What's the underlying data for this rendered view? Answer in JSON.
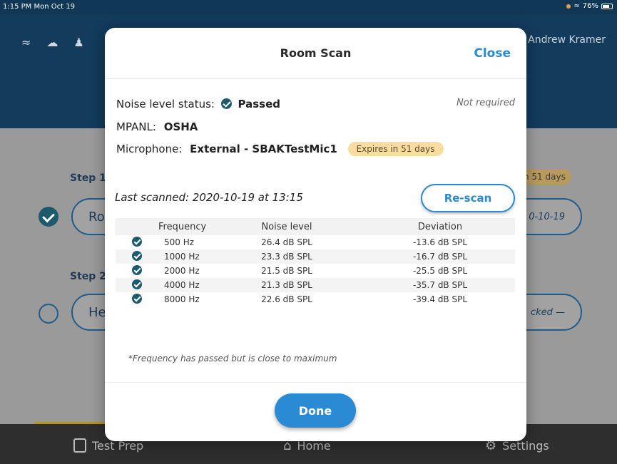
{
  "status_bar": {
    "time": "1:15 PM  Mon Oct 19",
    "battery": "76%",
    "accent_color": "#e8a33a"
  },
  "app": {
    "user_name": "Andrew Kramer",
    "steps": [
      {
        "label": "Step 1",
        "pill_text": "Ro",
        "right_text": "0-10-19"
      },
      {
        "label": "Step 2",
        "pill_text": "He",
        "right_text": "cked —"
      }
    ],
    "background_badge": "n 51 days",
    "tabs": [
      {
        "label": "Test Prep",
        "icon": "clipboard-icon"
      },
      {
        "label": "Home",
        "icon": "home-icon"
      },
      {
        "label": "Settings",
        "icon": "gear-icon"
      }
    ]
  },
  "modal": {
    "title": "Room Scan",
    "close_label": "Close",
    "noise_label": "Noise level status:",
    "noise_value": "Passed",
    "not_required": "Not required",
    "mpanl_label": "MPANL:",
    "mpanl_value": "OSHA",
    "mic_label": "Microphone:",
    "mic_value": "External - SBAKTestMic1",
    "expires_badge": "Expires in 51 days",
    "last_scanned": "Last scanned: 2020-10-19 at 13:15",
    "rescan_label": "Re-scan",
    "table": {
      "headers": [
        "Frequency",
        "Noise level",
        "Deviation"
      ],
      "rows": [
        {
          "frequency": "500 Hz",
          "noise": "26.4 dB SPL",
          "deviation": "-13.6 dB SPL"
        },
        {
          "frequency": "1000 Hz",
          "noise": "23.3 dB SPL",
          "deviation": "-16.7 dB SPL"
        },
        {
          "frequency": "2000 Hz",
          "noise": "21.5 dB SPL",
          "deviation": "-25.5 dB SPL"
        },
        {
          "frequency": "4000 Hz",
          "noise": "21.3 dB SPL",
          "deviation": "-35.7 dB SPL"
        },
        {
          "frequency": "8000 Hz",
          "noise": "22.6 dB SPL",
          "deviation": "-39.4 dB SPL"
        }
      ]
    },
    "footnote": "*Frequency has passed but is close to maximum",
    "done_label": "Done",
    "accent_color": "#2a8ad4",
    "pass_color": "#1d5a6e"
  }
}
